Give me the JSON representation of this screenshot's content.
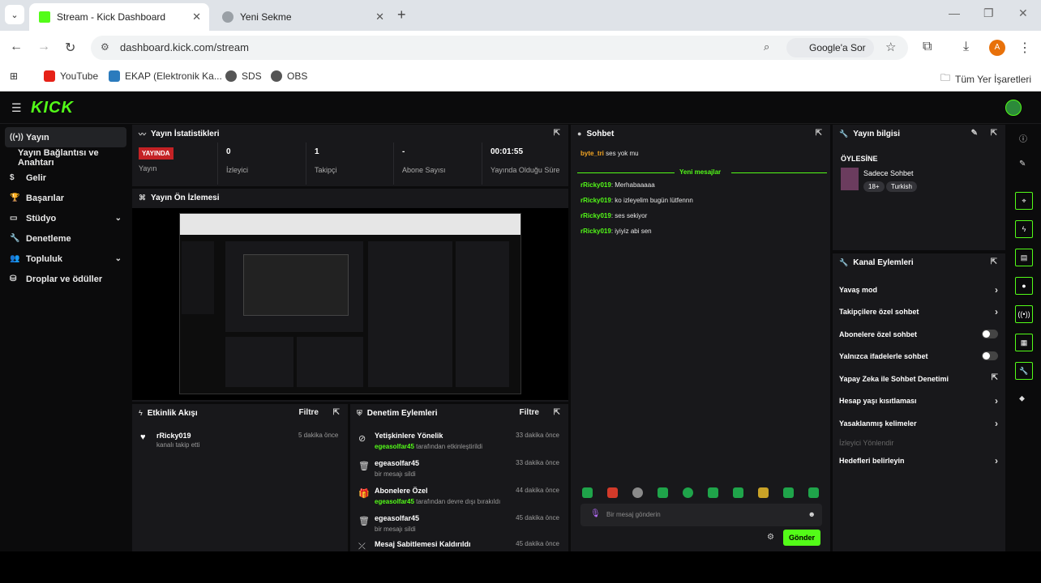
{
  "browser": {
    "tabs": [
      {
        "title": "Stream - Kick Dashboard"
      },
      {
        "title": "Yeni Sekme"
      }
    ],
    "url": "dashboard.kick.com/stream",
    "ask_google": "Google'a Sor",
    "profile_initial": "A",
    "bookmarks": [
      "YouTube",
      "EKAP (Elektronik Ka...",
      "SDS",
      "OBS"
    ],
    "all_bookmarks": "Tüm Yer İşaretleri"
  },
  "app": {
    "logo": "KICK",
    "sidebar": [
      {
        "label": "Yayın"
      },
      {
        "label": "Yayın Bağlantısı ve Anahtarı"
      },
      {
        "label": "Gelir"
      },
      {
        "label": "Başarılar"
      },
      {
        "label": "Stüdyo"
      },
      {
        "label": "Denetleme"
      },
      {
        "label": "Topluluk"
      },
      {
        "label": "Droplar ve ödüller"
      }
    ]
  },
  "stats": {
    "title": "Yayın İstatistikleri",
    "live_badge": "YAYINDA",
    "items": [
      {
        "value": "",
        "label": "Yayın"
      },
      {
        "value": "0",
        "label": "İzleyici"
      },
      {
        "value": "1",
        "label": "Takipçi"
      },
      {
        "value": "-",
        "label": "Abone Sayısı"
      },
      {
        "value": "00:01:55",
        "label": "Yayında Olduğu Süre"
      }
    ]
  },
  "preview": {
    "title": "Yayın Ön İzlemesi"
  },
  "activity": {
    "title": "Etkinlik Akışı",
    "filter": "Filtre",
    "items": [
      {
        "user": "rRicky019",
        "text": "kanalı takip etti",
        "time": "5 dakika önce"
      }
    ]
  },
  "moderation": {
    "title": "Denetim Eylemleri",
    "filter": "Filtre",
    "items": [
      {
        "title": "Yetişkinlere Yönelik",
        "user": "egeasolfar45",
        "text": "tarafından etkinleştirildi",
        "time": "33 dakika önce"
      },
      {
        "title": "egeasolfar45",
        "user": "",
        "text": "bir mesajı sildi",
        "time": "33 dakika önce"
      },
      {
        "title": "Abonelere Özel",
        "user": "egeasolfar45",
        "text": "tarafından devre dışı bırakıldı",
        "time": "44 dakika önce"
      },
      {
        "title": "egeasolfar45",
        "user": "",
        "text": "bir mesajı sildi",
        "time": "45 dakika önce"
      },
      {
        "title": "Mesaj Sabitlemesi Kaldırıldı",
        "user": "",
        "text": "",
        "time": "45 dakika önce"
      }
    ]
  },
  "chat": {
    "title": "Sohbet",
    "first": {
      "user": "byte_tri",
      "text": "ses yok mu"
    },
    "new_messages": "Yeni mesajlar",
    "messages": [
      {
        "user": "rRicky019",
        "text": "Merhabaaaaa"
      },
      {
        "user": "rRicky019",
        "text": "ko izleyelim bugün lütfennn"
      },
      {
        "user": "rRicky019",
        "text": "ses sekiyor"
      },
      {
        "user": "rRicky019",
        "text": "iyiyiz abi sen"
      }
    ],
    "placeholder": "Bir mesaj gönderin",
    "send": "Gönder"
  },
  "stream_info": {
    "title": "Yayın bilgisi",
    "stream_title": "ÖYLESİNE",
    "category": "Sadece Sohbet",
    "tags": [
      "18+",
      "Turkish"
    ]
  },
  "channel_actions": {
    "title": "Kanal Eylemleri",
    "items": [
      {
        "label": "Yavaş mod",
        "kind": "arrow"
      },
      {
        "label": "Takipçilere özel sohbet",
        "kind": "arrow"
      },
      {
        "label": "Abonelere özel sohbet",
        "kind": "toggle"
      },
      {
        "label": "Yalnızca ifadelerle sohbet",
        "kind": "toggle"
      },
      {
        "label": "Yapay Zeka ile Sohbet Denetimi",
        "kind": "popout"
      },
      {
        "label": "Hesap yaşı kısıtlaması",
        "kind": "arrow"
      },
      {
        "label": "Yasaklanmış kelimeler",
        "kind": "arrow"
      },
      {
        "label": "İzleyici Yönlendir",
        "kind": "dim"
      },
      {
        "label": "Hedefleri belirleyin",
        "kind": "arrow"
      }
    ]
  },
  "colors": {
    "accent": "#53fc18",
    "live": "#c42225",
    "panel": "#18181b"
  }
}
